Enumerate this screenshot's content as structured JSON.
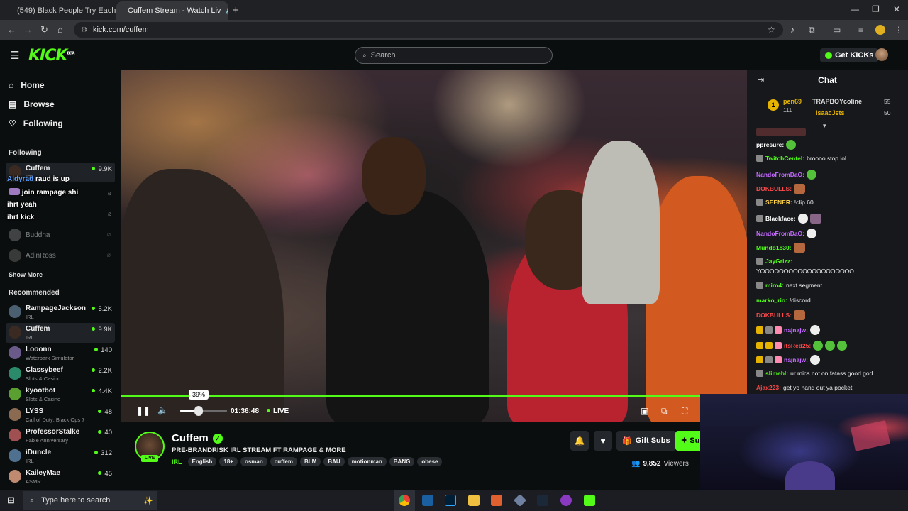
{
  "browser": {
    "tabs": [
      {
        "title": "(549) Black People Try Each Oth",
        "icon": "youtube-icon",
        "active": false
      },
      {
        "title": "Cuffem Stream - Watch Liv",
        "icon": "kick-icon",
        "active": true
      }
    ],
    "url": "kick.com/cuffem"
  },
  "header": {
    "logo": "KICK",
    "logo_sup": "BETA",
    "search_placeholder": "Search",
    "get_kicks": "Get KICKs"
  },
  "sidebar": {
    "nav": [
      {
        "label": "Home",
        "icon": "home-icon"
      },
      {
        "label": "Browse",
        "icon": "browse-icon"
      },
      {
        "label": "Following",
        "icon": "heart-icon"
      }
    ],
    "following_title": "Following",
    "following": [
      {
        "name": "Cuffem",
        "category": "IRL",
        "viewers": "9.9K"
      },
      {
        "name": "Buddha",
        "category": "",
        "viewers": ""
      },
      {
        "name": "AdinRoss",
        "category": "",
        "viewers": ""
      }
    ],
    "overlay_lines": [
      {
        "user": "Aldyrad",
        "text": "raud is up"
      },
      {
        "user": "",
        "text": "join rampage shi"
      },
      {
        "user": "ihrt",
        "text": "yeah"
      },
      {
        "user": "ihrt",
        "text": "kick"
      }
    ],
    "show_more": "Show More",
    "recommended_title": "Recommended",
    "recommended": [
      {
        "name": "RampageJackson",
        "category": "IRL",
        "viewers": "5.2K"
      },
      {
        "name": "Cuffem",
        "category": "IRL",
        "viewers": "9.9K"
      },
      {
        "name": "Looonn",
        "category": "Waterpark Simulator",
        "viewers": "140"
      },
      {
        "name": "Classybeef",
        "category": "Slots & Casino",
        "viewers": "2.2K"
      },
      {
        "name": "kyootbot",
        "category": "Slots & Casino",
        "viewers": "4.4K"
      },
      {
        "name": "LYSS",
        "category": "Call of Duty: Black Ops 7",
        "viewers": "48"
      },
      {
        "name": "ProfessorStalke",
        "category": "Fable Anniversary",
        "viewers": "40"
      },
      {
        "name": "iDuncle",
        "category": "IRL",
        "viewers": "312"
      },
      {
        "name": "KaileyMae",
        "category": "ASMR",
        "viewers": "45"
      }
    ]
  },
  "player": {
    "volume_tooltip": "39%",
    "volume_level": 0.39,
    "time": "01:36:48",
    "live": "LIVE"
  },
  "stream": {
    "name": "Cuffem",
    "live_badge": "LIVE",
    "title": "PRE-BRANDRISK IRL STREAM FT RAMPAGE & MORE",
    "category": "IRL",
    "tags": [
      "English",
      "18+",
      "osman",
      "cuffem",
      "BLM",
      "BAU",
      "motionman",
      "BANG",
      "obese"
    ],
    "gift_subs": "Gift Subs",
    "subscribe": "Su",
    "viewer_count": "9,852",
    "viewers_label": "Viewers"
  },
  "chat": {
    "title": "Chat",
    "pinned": [
      {
        "rank": "1",
        "user": "pen69",
        "amount": "111"
      },
      {
        "user": "TRAPBOYcoline",
        "amount": "55"
      },
      {
        "user": "IsaacJets",
        "amount": "50"
      }
    ],
    "messages": [
      {
        "user": "ppresure:",
        "text": "",
        "color": "#ffffff"
      },
      {
        "user": "TwitchCentel:",
        "text": "broooo stop lol",
        "color": "#53fc18"
      },
      {
        "user": "NandoFromDaO:",
        "text": "",
        "color": "#c56bff"
      },
      {
        "user": "DOKBULLS:",
        "text": "",
        "color": "#ff4a4a"
      },
      {
        "user": "SEENER:",
        "text": "!clip 60",
        "color": "#ffd24a"
      },
      {
        "user": "Blackface:",
        "text": "",
        "color": "#ffffff"
      },
      {
        "user": "NandoFromDaO:",
        "text": "",
        "color": "#c56bff"
      },
      {
        "user": "Mundo1830:",
        "text": "",
        "color": "#53fc18"
      },
      {
        "user": "JayGrizz:",
        "text": "",
        "color": "#53fc18"
      },
      {
        "user": "",
        "text": "YOOOOOOOOOOOOOOOOOOOO",
        "color": "#ffffff"
      },
      {
        "user": "miro4:",
        "text": "next segment",
        "color": "#53fc18"
      },
      {
        "user": "marko_rio:",
        "text": "!discord",
        "color": "#53fc18"
      },
      {
        "user": "DOKBULLS:",
        "text": "",
        "color": "#ff4a4a"
      },
      {
        "user": "najnajw:",
        "text": "",
        "color": "#c56bff"
      },
      {
        "user": "itsRed25:",
        "text": "",
        "color": "#ff4a4a"
      },
      {
        "user": "najnajw:",
        "text": "",
        "color": "#c56bff"
      },
      {
        "user": "slimebl:",
        "text": "ur mics not on fatass good god",
        "color": "#53fc18"
      },
      {
        "user": "Ajax223:",
        "text": "get yo hand out ya pocket",
        "color": "#ff4a4a"
      }
    ]
  },
  "taskbar": {
    "search_placeholder": "Type here to search"
  }
}
